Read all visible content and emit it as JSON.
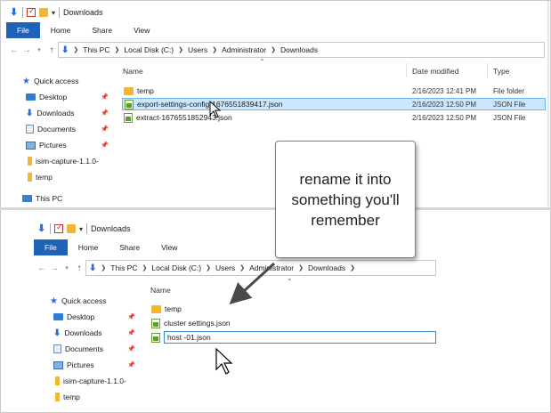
{
  "top": {
    "title": "Downloads",
    "ribbon_tabs": [
      "File",
      "Home",
      "Share",
      "View"
    ],
    "address": [
      "This PC",
      "Local Disk (C:)",
      "Users",
      "Administrator",
      "Downloads"
    ],
    "nav": {
      "quick_access": "Quick access",
      "items": [
        "Desktop",
        "Downloads",
        "Documents",
        "Pictures",
        "isim-capture-1.1.0-",
        "temp"
      ],
      "this_pc": "This PC"
    },
    "columns": {
      "name": "Name",
      "date": "Date modified",
      "type": "Type"
    },
    "files": [
      {
        "name": "temp",
        "date": "2/16/2023 12:41 PM",
        "type": "File folder"
      },
      {
        "name": "export-settings-config-1676551839417.json",
        "date": "2/16/2023 12:50 PM",
        "type": "JSON File"
      },
      {
        "name": "extract-1676551852943.json",
        "date": "2/16/2023 12:50 PM",
        "type": "JSON File"
      }
    ]
  },
  "bottom": {
    "title": "Downloads",
    "ribbon_tabs": [
      "File",
      "Home",
      "Share",
      "View"
    ],
    "address": [
      "This PC",
      "Local Disk (C:)",
      "Users",
      "Administrator",
      "Downloads"
    ],
    "nav": {
      "quick_access": "Quick access",
      "items": [
        "Desktop",
        "Downloads",
        "Documents",
        "Pictures",
        "isim-capture-1.1.0-",
        "temp"
      ]
    },
    "columns": {
      "name": "Name"
    },
    "files": [
      {
        "name": "temp"
      },
      {
        "name": "cluster settings.json"
      }
    ],
    "rename_value": "host -01.json"
  },
  "callout": {
    "text": "rename it into something you'll remember"
  },
  "colors": {
    "file_tab": "#1e63b8",
    "selection": "#cce6fb",
    "accent": "#2d6bd6"
  }
}
